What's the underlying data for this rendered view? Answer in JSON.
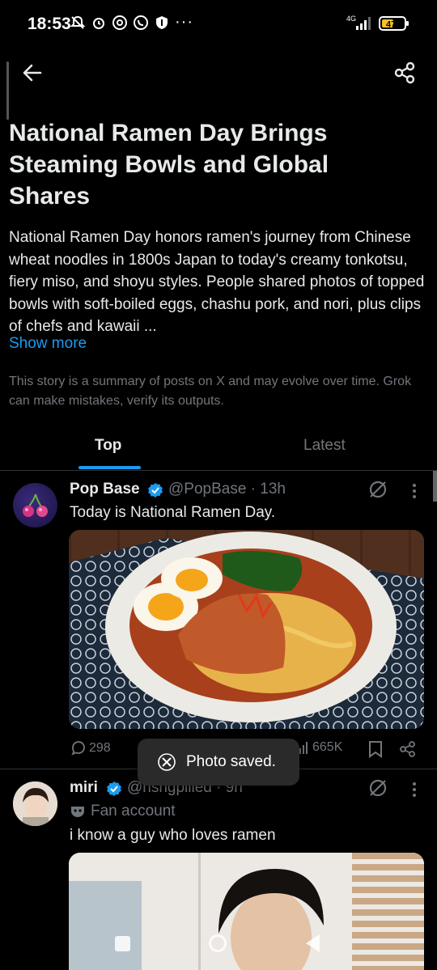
{
  "status_bar": {
    "time": "18:53",
    "network": "4G",
    "battery": "47",
    "more": "···"
  },
  "article": {
    "headline": "National Ramen Day Brings Steaming Bowls and Global Shares",
    "summary": "National Ramen Day honors ramen's journey from Chinese wheat noodles in 1800s Japan to today's creamy tonkotsu, fiery miso, and shoyu styles. People shared photos of topped bowls with soft-boiled eggs, chashu pork, and nori, plus clips of chefs and kawaii ...",
    "show_more": "Show more",
    "disclaimer": "This story is a summary of posts on X and may evolve over time. Grok can make mistakes, verify its outputs."
  },
  "tabs": [
    {
      "label": "Top",
      "active": true
    },
    {
      "label": "Latest",
      "active": false
    }
  ],
  "posts": [
    {
      "name": "Pop Base",
      "handle": "@PopBase · 13h",
      "text": "Today is National Ramen Day.",
      "replies": "298",
      "views": "665K"
    },
    {
      "name": "miri",
      "handle": "@hsngpilled · 9h",
      "label": "Fan account",
      "text": "i know a guy who loves ramen"
    }
  ],
  "toast": {
    "text": "Photo saved."
  },
  "colors": {
    "accent": "#1d9bf0",
    "secondary_text": "#71767b",
    "background": "#000000"
  }
}
